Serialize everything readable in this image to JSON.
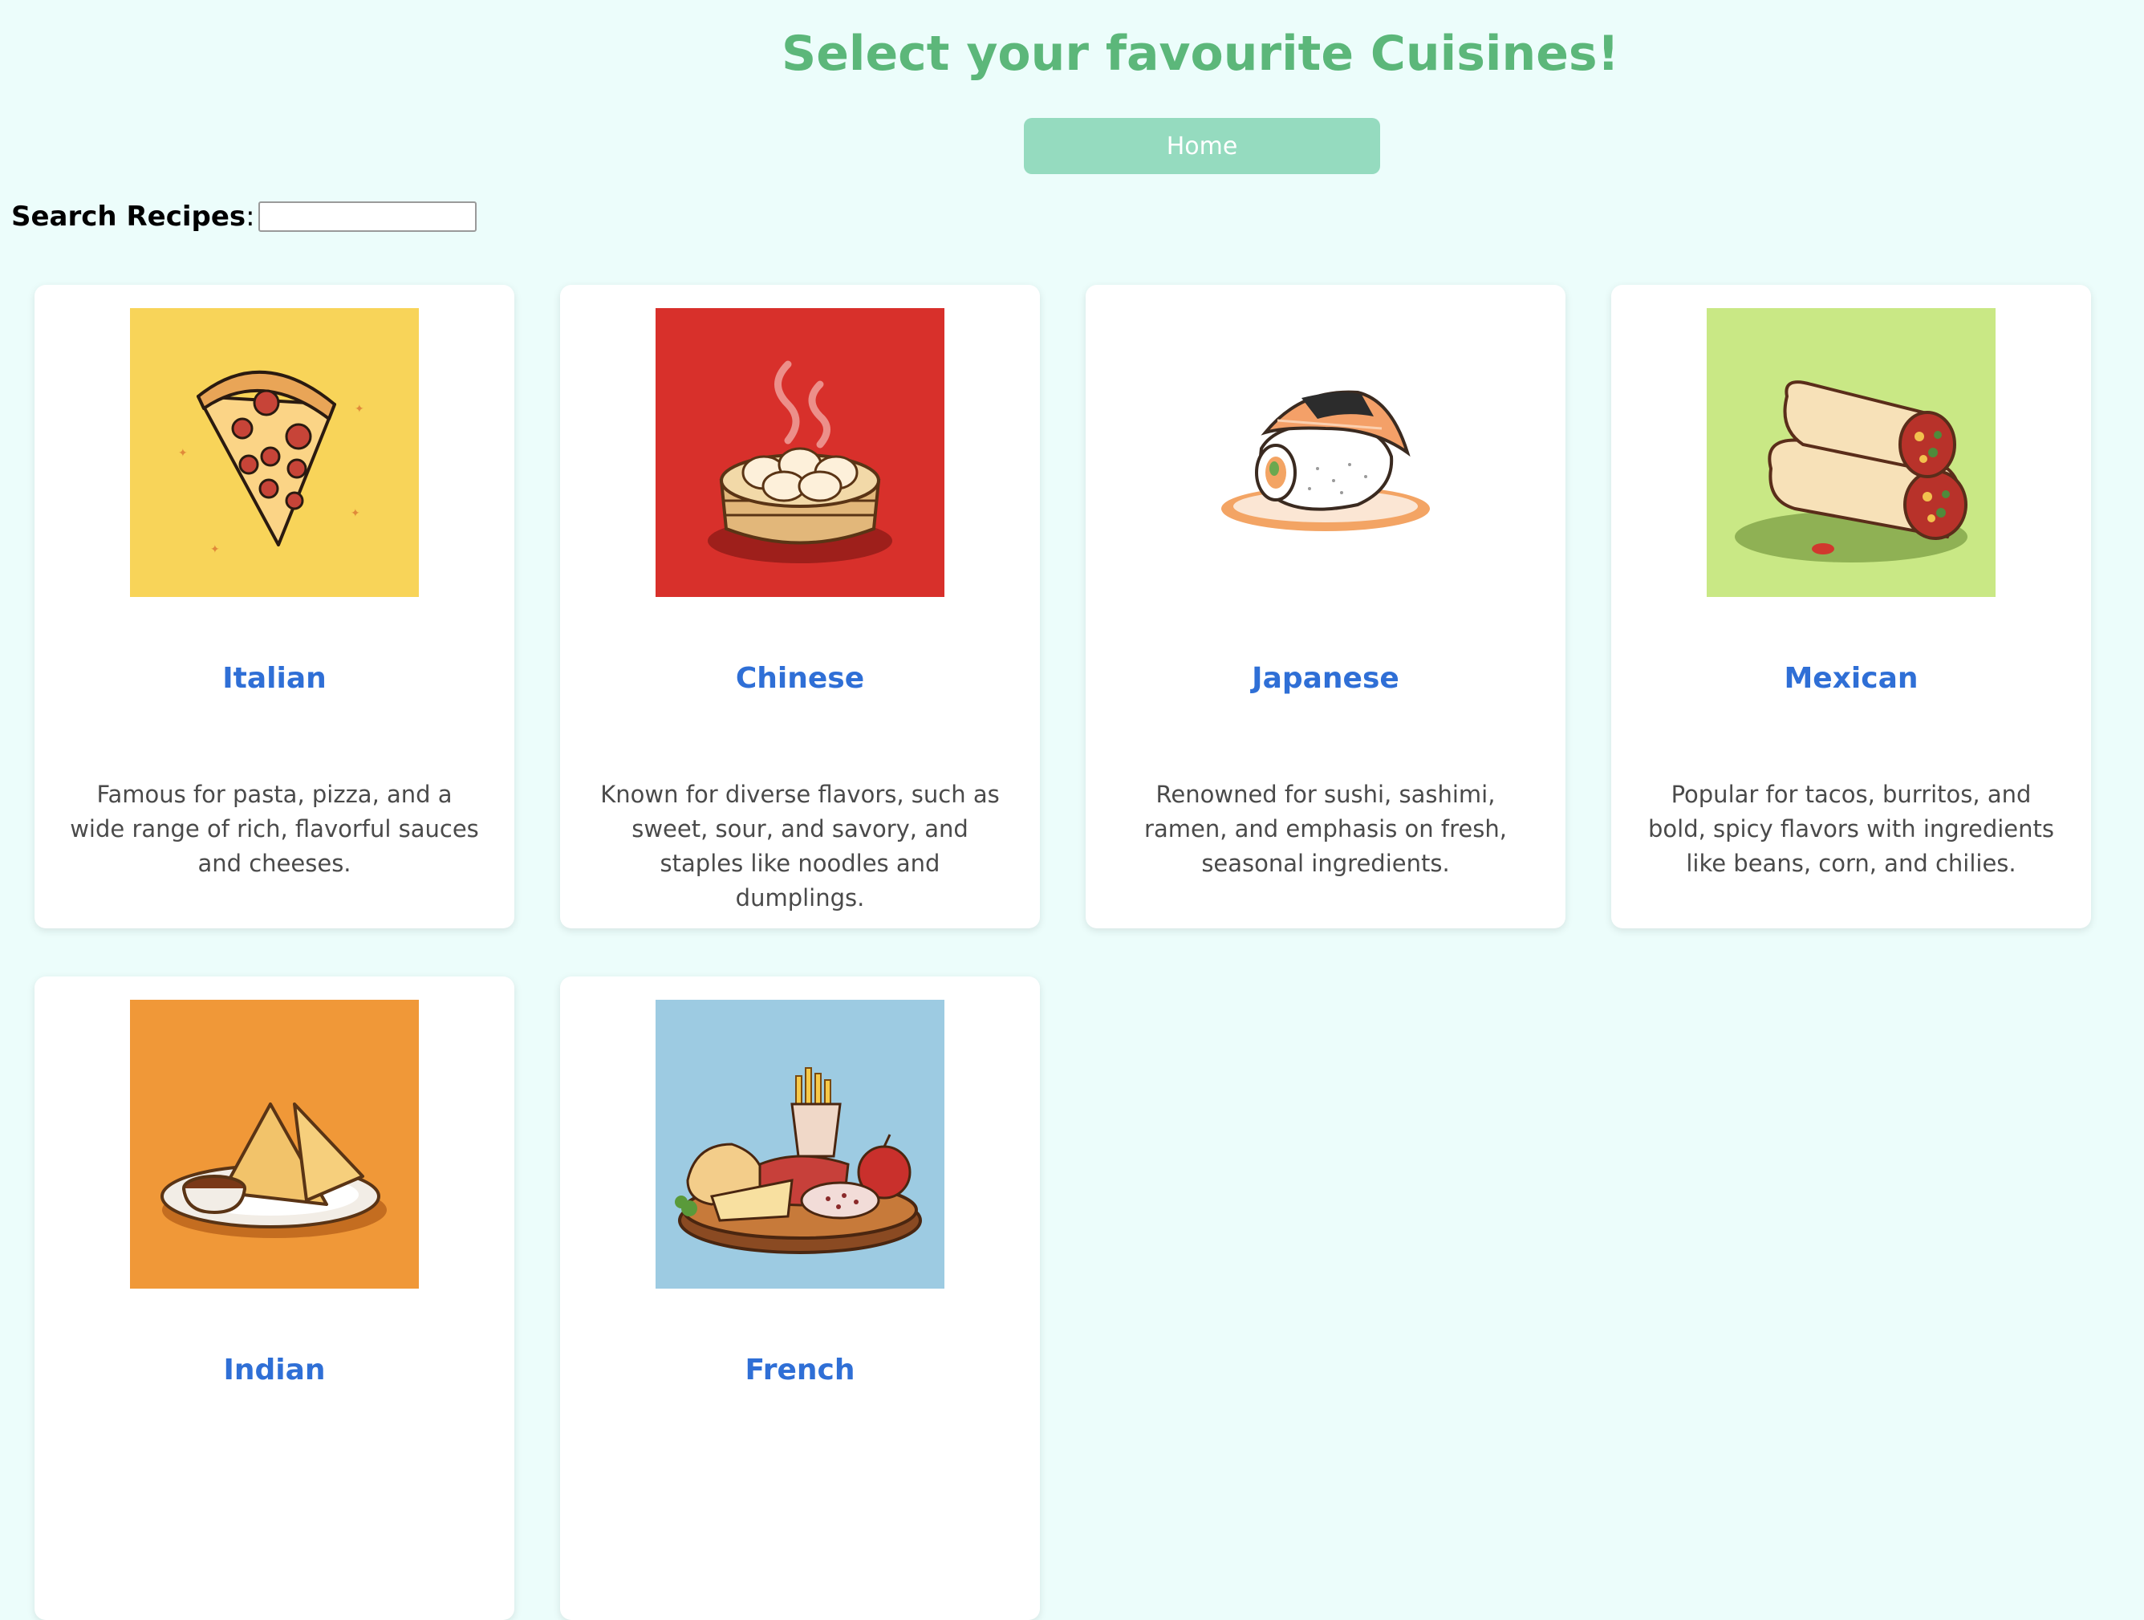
{
  "header": {
    "title": "Select your favourite Cuisines!",
    "home_label": "Home"
  },
  "search": {
    "label": "Search Recipes",
    "colon": ":",
    "value": "",
    "placeholder": ""
  },
  "colors": {
    "background": "#ecfdfb",
    "title": "#5cb77a",
    "home_button": "#95dbbf",
    "card_title": "#2f6fd6"
  },
  "cuisines": [
    {
      "name": "Italian",
      "description": "Famous for pasta, pizza, and a wide range of rich, flavorful sauces and cheeses.",
      "image": "pizza-slice-image",
      "bg": "#f8d459"
    },
    {
      "name": "Chinese",
      "description": "Known for diverse flavors, such as sweet, sour, and savory, and staples like noodles and dumplings.",
      "image": "dumpling-steamer-image",
      "bg": "#d8302b"
    },
    {
      "name": "Japanese",
      "description": "Renowned for sushi, sashimi, ramen, and emphasis on fresh, seasonal ingredients.",
      "image": "sushi-image",
      "bg": "#ffffff"
    },
    {
      "name": "Mexican",
      "description": "Popular for tacos, burritos, and bold, spicy flavors with ingredients like beans, corn, and chilies.",
      "image": "burrito-image",
      "bg": "#c9e885"
    },
    {
      "name": "Indian",
      "description": "",
      "image": "samosa-image",
      "bg": "#f09838"
    },
    {
      "name": "French",
      "description": "",
      "image": "french-platter-image",
      "bg": "#9dcbe2"
    }
  ]
}
